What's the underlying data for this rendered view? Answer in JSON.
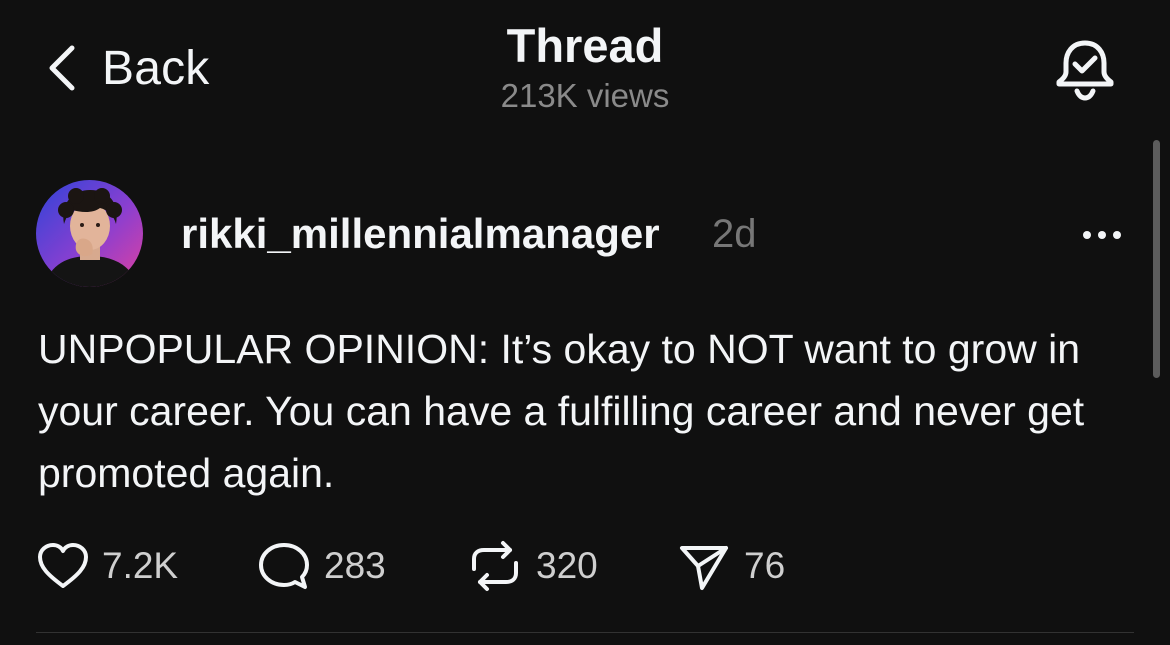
{
  "header": {
    "back_label": "Back",
    "title": "Thread",
    "views": "213K views"
  },
  "post": {
    "username": "rikki_millennialmanager",
    "time": "2d",
    "text": "UNPOPULAR OPINION: It’s okay to NOT want to grow in your career. You can have a fulfilling career and never get promoted again.",
    "likes": "7.2K",
    "replies": "283",
    "reposts": "320",
    "shares": "76"
  },
  "icons": {
    "back": "chevron-left-icon",
    "notifications": "bell-check-icon",
    "more": "more-horizontal-icon",
    "like": "heart-icon",
    "reply": "comment-bubble-icon",
    "repost": "repost-icon",
    "share": "send-icon"
  },
  "colors": {
    "background": "#101010",
    "primary_text": "#f3f5f7",
    "secondary_text": "#8a8a8a",
    "avatar_gradient_start": "#3b4ad8",
    "avatar_gradient_end": "#d43fb5"
  }
}
